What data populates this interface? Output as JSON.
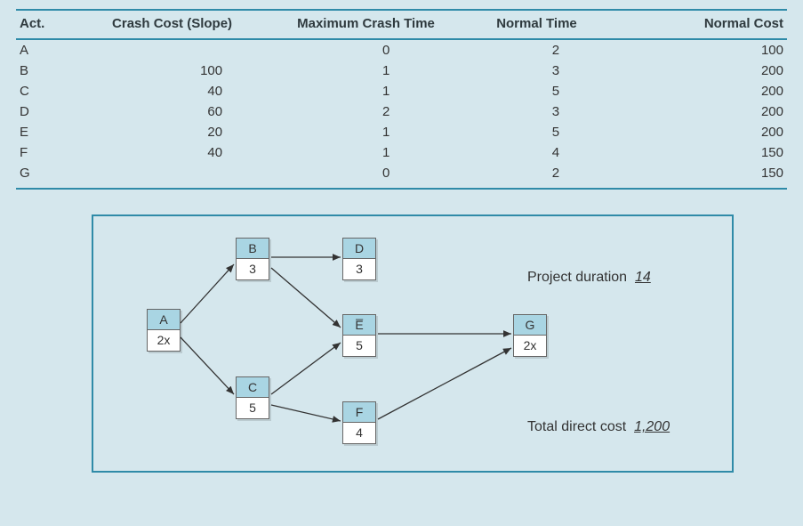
{
  "table": {
    "headers": {
      "act": "Act.",
      "slope": "Crash Cost (Slope)",
      "max": "Maximum Crash Time",
      "ntime": "Normal Time",
      "ncost": "Normal Cost"
    },
    "rows": [
      {
        "act": "A",
        "slope": "",
        "max": "0",
        "ntime": "2",
        "ncost": "100"
      },
      {
        "act": "B",
        "slope": "100",
        "max": "1",
        "ntime": "3",
        "ncost": "200"
      },
      {
        "act": "C",
        "slope": "40",
        "max": "1",
        "ntime": "5",
        "ncost": "200"
      },
      {
        "act": "D",
        "slope": "60",
        "max": "2",
        "ntime": "3",
        "ncost": "200"
      },
      {
        "act": "E",
        "slope": "20",
        "max": "1",
        "ntime": "5",
        "ncost": "200"
      },
      {
        "act": "F",
        "slope": "40",
        "max": "1",
        "ntime": "4",
        "ncost": "150"
      },
      {
        "act": "G",
        "slope": "",
        "max": "0",
        "ntime": "2",
        "ncost": "150"
      }
    ]
  },
  "diagram": {
    "nodes": {
      "A": {
        "label": "A",
        "value": "2x"
      },
      "B": {
        "label": "B",
        "value": "3"
      },
      "C": {
        "label": "C",
        "value": "5"
      },
      "D": {
        "label": "D",
        "value": "3"
      },
      "E": {
        "label": "E̅",
        "value": "5"
      },
      "F": {
        "label": "F",
        "value": "4"
      },
      "G": {
        "label": "G",
        "value": "2x"
      }
    },
    "duration_label": "Project duration",
    "duration_value": "14",
    "cost_label": "Total direct cost",
    "cost_value": "1,200"
  },
  "chart_data": {
    "type": "table",
    "title": "Activity crash cost/time table with project network diagram",
    "columns": [
      "Act.",
      "Crash Cost (Slope)",
      "Maximum Crash Time",
      "Normal Time",
      "Normal Cost"
    ],
    "rows": [
      [
        "A",
        null,
        0,
        2,
        100
      ],
      [
        "B",
        100,
        1,
        3,
        200
      ],
      [
        "C",
        40,
        1,
        5,
        200
      ],
      [
        "D",
        60,
        2,
        3,
        200
      ],
      [
        "E",
        20,
        1,
        5,
        200
      ],
      [
        "F",
        40,
        1,
        4,
        150
      ],
      [
        "G",
        null,
        0,
        2,
        150
      ]
    ],
    "network": {
      "nodes": [
        {
          "id": "A",
          "duration": 2,
          "crashed_fully": true
        },
        {
          "id": "B",
          "duration": 3
        },
        {
          "id": "C",
          "duration": 5
        },
        {
          "id": "D",
          "duration": 3
        },
        {
          "id": "E",
          "duration": 5,
          "critical": true
        },
        {
          "id": "F",
          "duration": 4
        },
        {
          "id": "G",
          "duration": 2,
          "crashed_fully": true
        }
      ],
      "edges": [
        [
          "A",
          "B"
        ],
        [
          "A",
          "C"
        ],
        [
          "B",
          "D"
        ],
        [
          "B",
          "E"
        ],
        [
          "C",
          "E"
        ],
        [
          "C",
          "F"
        ],
        [
          "E",
          "G"
        ],
        [
          "F",
          "G"
        ]
      ],
      "project_duration": 14,
      "total_direct_cost": 1200
    }
  }
}
